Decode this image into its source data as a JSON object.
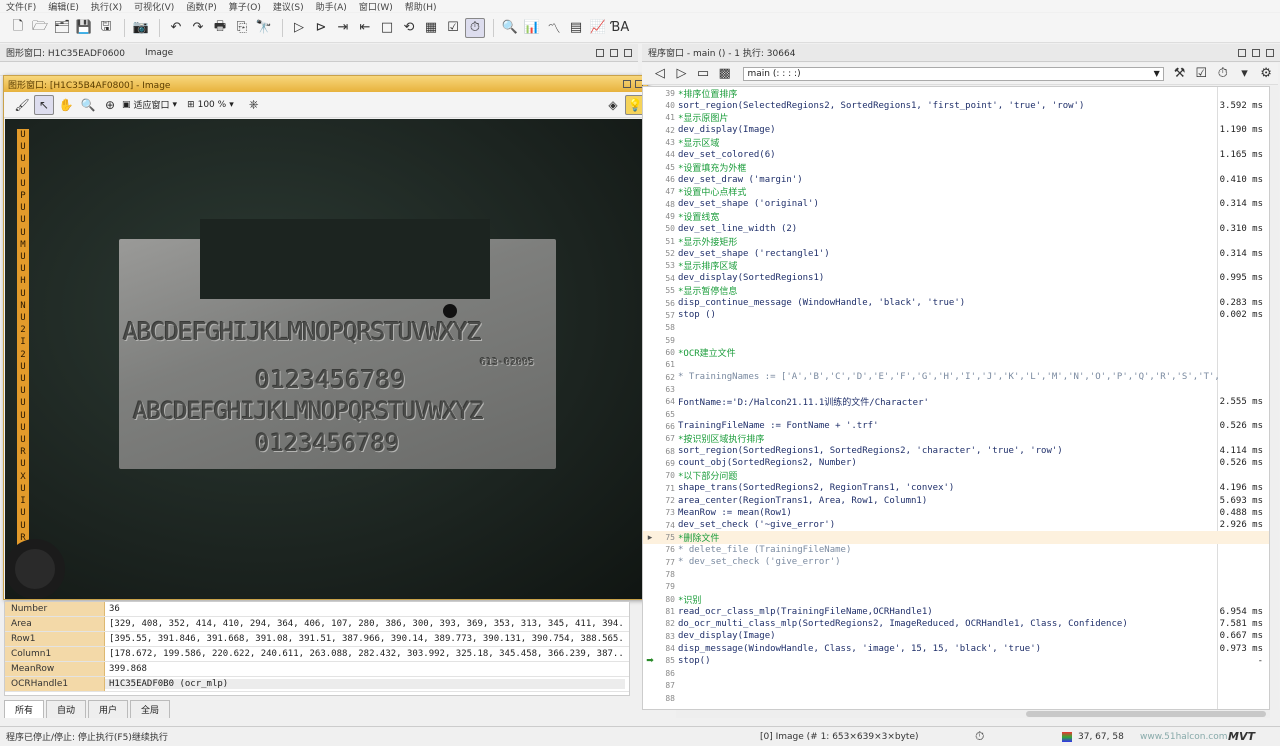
{
  "menu": [
    "文件(F)",
    "编辑(E)",
    "执行(X)",
    "可视化(V)",
    "函数(P)",
    "算子(O)",
    "建议(S)",
    "助手(A)",
    "窗口(W)",
    "帮助(H)"
  ],
  "graphics_panel": {
    "title": "图形窗口: H1C35EADF0600",
    "subtitle": "Image"
  },
  "float_window": {
    "title": "图形窗口: [H1C35B4AF0800] - Image",
    "mode_label": "适应窗口",
    "zoom_label": "100 %"
  },
  "image_content": {
    "strip_letters": [
      "U",
      "U",
      "U",
      "U",
      "U",
      "P",
      "U",
      "U",
      "U",
      "M",
      "U",
      "U",
      "H",
      "U",
      "N",
      "U",
      "2",
      "I",
      "2",
      "U",
      "U",
      "U",
      "U",
      "U",
      "U",
      "U",
      "R",
      "U",
      "X",
      "U",
      "I",
      "U",
      "U",
      "R",
      "U"
    ],
    "row1": "ABCDEFGHIJKLMNOPQRSTUVWXYZ",
    "row2": "0123456789",
    "row3": "ABCDEFGHIJKLMNOPQRSTUVWXYZ",
    "row4": "0123456789",
    "part_no": "613-02005"
  },
  "variables": [
    {
      "name": "Number",
      "value": "36"
    },
    {
      "name": "Area",
      "value": "[329, 408, 352, 414, 410, 294, 364, 406, 107, 280, 386, 300, 393, 369, 353, 313, 345, 411, 394..."
    },
    {
      "name": "Row1",
      "value": "[395.55, 391.846, 391.668, 391.08, 391.51, 387.966, 390.14, 389.773, 390.131, 390.754, 388.565..."
    },
    {
      "name": "Column1",
      "value": "[178.672, 199.586, 220.622, 240.611, 263.088, 282.432, 303.992, 325.18, 345.458, 366.239, 387..."
    },
    {
      "name": "MeanRow",
      "value": "399.868"
    },
    {
      "name": "OCRHandle1",
      "value": "H1C35EADF0B0 (ocr_mlp)"
    }
  ],
  "var_tabs": [
    "所有",
    "自动",
    "用户",
    "全局"
  ],
  "program_panel": {
    "title": "程序窗口 - main () - 1 执行: 30664",
    "procedure": "main (: : : :)"
  },
  "code_lines": [
    {
      "n": "39",
      "kind": "comment",
      "text": "*排序位置排序",
      "time": ""
    },
    {
      "n": "40",
      "kind": "code",
      "text": "sort_region(SelectedRegions2, SortedRegions1, 'first_point', 'true', 'row')",
      "time": "3.592 ms"
    },
    {
      "n": "41",
      "kind": "comment",
      "text": "*显示原图片",
      "time": ""
    },
    {
      "n": "42",
      "kind": "code",
      "text": "dev_display(Image)",
      "time": "1.190 ms"
    },
    {
      "n": "43",
      "kind": "comment",
      "text": "*显示区域",
      "time": ""
    },
    {
      "n": "44",
      "kind": "code",
      "text": "dev_set_colored(6)",
      "time": "1.165 ms"
    },
    {
      "n": "45",
      "kind": "comment",
      "text": "*设置填充为外框",
      "time": ""
    },
    {
      "n": "46",
      "kind": "code",
      "text": "dev_set_draw ('margin')",
      "time": "0.410 ms"
    },
    {
      "n": "47",
      "kind": "comment",
      "text": "*设置中心点样式",
      "time": ""
    },
    {
      "n": "48",
      "kind": "code",
      "text": "dev_set_shape ('original')",
      "time": "0.314 ms"
    },
    {
      "n": "49",
      "kind": "comment",
      "text": "*设置线宽",
      "time": ""
    },
    {
      "n": "50",
      "kind": "code",
      "text": "dev_set_line_width (2)",
      "time": "0.310 ms"
    },
    {
      "n": "51",
      "kind": "comment",
      "text": "*显示外接矩形",
      "time": ""
    },
    {
      "n": "52",
      "kind": "code",
      "text": "dev_set_shape ('rectangle1')",
      "time": "0.314 ms"
    },
    {
      "n": "53",
      "kind": "comment",
      "text": "*显示排序区域",
      "time": ""
    },
    {
      "n": "54",
      "kind": "code",
      "text": "dev_display(SortedRegions1)",
      "time": "0.995 ms"
    },
    {
      "n": "55",
      "kind": "comment",
      "text": "*显示暂停信息",
      "time": ""
    },
    {
      "n": "56",
      "kind": "code",
      "text": "disp_continue_message (WindowHandle, 'black', 'true')",
      "time": "0.283 ms"
    },
    {
      "n": "57",
      "kind": "code",
      "text": "stop ()",
      "time": "0.002 ms"
    },
    {
      "n": "58",
      "kind": "blank",
      "text": "",
      "time": ""
    },
    {
      "n": "59",
      "kind": "blank",
      "text": "",
      "time": ""
    },
    {
      "n": "60",
      "kind": "comment",
      "text": "*OCR建立文件",
      "time": ""
    },
    {
      "n": "61",
      "kind": "blank",
      "text": "",
      "time": ""
    },
    {
      "n": "62",
      "kind": "commented",
      "text": "* TrainingNames := ['A','B','C','D','E','F','G','H','I','J','K','L','M','N','O','P','Q','R','S','T',",
      "time": ""
    },
    {
      "n": "63",
      "kind": "blank",
      "text": "",
      "time": ""
    },
    {
      "n": "64",
      "kind": "code",
      "text": "FontName:='D:/Halcon21.11.1训练的文件/Character'",
      "time": "2.555 ms"
    },
    {
      "n": "65",
      "kind": "blank",
      "text": "",
      "time": ""
    },
    {
      "n": "66",
      "kind": "code",
      "text": "TrainingFileName := FontName + '.trf'",
      "time": "0.526 ms"
    },
    {
      "n": "67",
      "kind": "comment",
      "text": "*按识别区域执行排序",
      "time": ""
    },
    {
      "n": "68",
      "kind": "code",
      "text": "sort_region(SortedRegions1, SortedRegions2, 'character', 'true', 'row')",
      "time": "4.114 ms"
    },
    {
      "n": "69",
      "kind": "code",
      "text": "count_obj(SortedRegions2, Number)",
      "time": "0.526 ms"
    },
    {
      "n": "70",
      "kind": "comment",
      "text": "*以下部分问题",
      "time": ""
    },
    {
      "n": "71",
      "kind": "code",
      "text": "shape_trans(SortedRegions2, RegionTrans1, 'convex')",
      "time": "4.196 ms"
    },
    {
      "n": "72",
      "kind": "code",
      "text": "area_center(RegionTrans1, Area, Row1, Column1)",
      "time": "5.693 ms"
    },
    {
      "n": "73",
      "kind": "code",
      "text": "MeanRow := mean(Row1)",
      "time": "0.488 ms"
    },
    {
      "n": "74",
      "kind": "code",
      "text": "dev_set_check ('~give_error')",
      "time": "2.926 ms"
    },
    {
      "n": "75",
      "kind": "comment",
      "text": "*删除文件",
      "time": ""
    },
    {
      "n": "76",
      "kind": "commented",
      "text": "* delete_file (TrainingFileName)",
      "time": ""
    },
    {
      "n": "77",
      "kind": "commented",
      "text": "* dev_set_check ('give_error')",
      "time": ""
    },
    {
      "n": "78",
      "kind": "blank",
      "text": "",
      "time": ""
    },
    {
      "n": "79",
      "kind": "blank",
      "text": "",
      "time": ""
    },
    {
      "n": "80",
      "kind": "comment",
      "text": "*识别",
      "time": ""
    },
    {
      "n": "81",
      "kind": "code",
      "text": "read_ocr_class_mlp(TrainingFileName,OCRHandle1)",
      "time": "6.954 ms"
    },
    {
      "n": "82",
      "kind": "code",
      "text": "do_ocr_multi_class_mlp(SortedRegions2, ImageReduced, OCRHandle1, Class, Confidence)",
      "time": "7.581 ms"
    },
    {
      "n": "83",
      "kind": "code",
      "text": "dev_display(Image)",
      "time": "0.667 ms"
    },
    {
      "n": "84",
      "kind": "code",
      "text": "disp_message(WindowHandle, Class, 'image', 15, 15, 'black', 'true')",
      "time": "0.973 ms"
    },
    {
      "n": "85",
      "kind": "code",
      "text": "stop()",
      "time": "-"
    },
    {
      "n": "86",
      "kind": "blank",
      "text": "",
      "time": ""
    },
    {
      "n": "87",
      "kind": "blank",
      "text": "",
      "time": ""
    },
    {
      "n": "88",
      "kind": "blank",
      "text": "",
      "time": ""
    }
  ],
  "status": {
    "left": "程序已停止/停止: 停止执行(F5)继续执行",
    "image_info": "[0] Image (# 1: 653×639×3×byte)",
    "coords": "37, 67, 58",
    "watermark": "www.51halcon.com",
    "logo": "MVT"
  },
  "colors": {
    "accent_orange": "#e7b23d",
    "comment_green": "#1a9c3a",
    "code_blue": "#1f2f6a"
  }
}
